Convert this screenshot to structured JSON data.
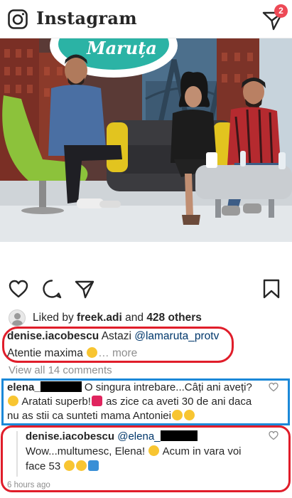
{
  "header": {
    "app_name": "Instagram",
    "dm_badge_count": "2"
  },
  "post": {
    "photo_sign_text": "Maruța"
  },
  "likes": {
    "prefix": "Liked by",
    "user": "freek.adi",
    "connector": "and",
    "others": "428 others"
  },
  "caption": {
    "user": "denise.iacobescu",
    "text": "Astazi",
    "mention": "@lamaruta_protv",
    "line2": "Atentie maxima",
    "ellipsis": "…",
    "more": "more"
  },
  "comments": {
    "view_all": "View all 14 comments",
    "comment1": {
      "user": "elena_",
      "text_a": "O singura intrebare...Câți ani aveți?",
      "text_b": "Aratati superb!",
      "text_c": "as zice ca aveti 30 de ani daca nu as stii ca sunteti mama Antoniei"
    },
    "reply": {
      "user": "denise.iacobescu",
      "mention": "@elena_",
      "text_a": "Wow...multumesc, Elena!",
      "text_b": "Acum in vara voi face 53",
      "timestamp": "6 hours ago"
    }
  },
  "colors": {
    "badge": "#ed4956",
    "mention": "#00376b",
    "muted": "#8e8e8e",
    "annotation_red": "#e01d2a",
    "annotation_blue": "#1b88d8"
  }
}
